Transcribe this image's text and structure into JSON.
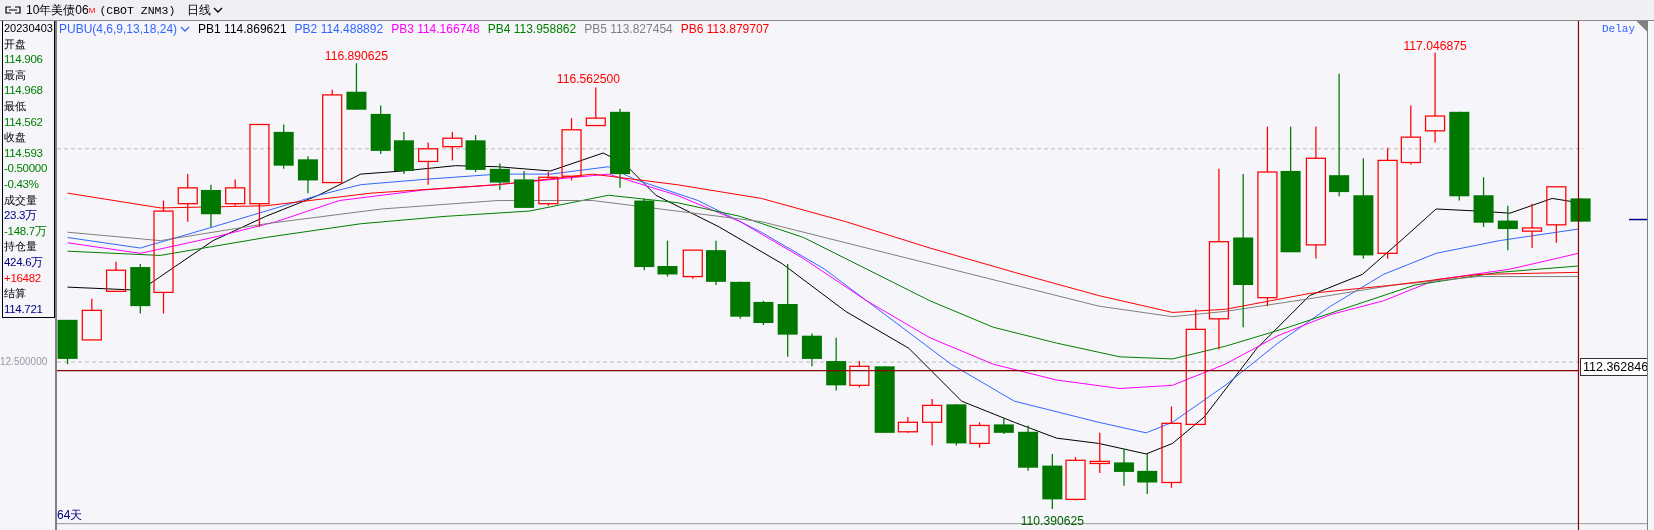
{
  "title_bar": {
    "symbol": "10年美债06",
    "symbol_mark": "M",
    "contract": "(CBOT ZNM3)",
    "period": "日线"
  },
  "info_panel": {
    "entries": [
      {
        "text": "20230403"
      },
      {
        "text": "开盘"
      },
      {
        "text": "114.906",
        "color": "#008000"
      },
      {
        "text": "最高"
      },
      {
        "text": "114.968",
        "color": "#008000"
      },
      {
        "text": "最低"
      },
      {
        "text": "114.562",
        "color": "#008000"
      },
      {
        "text": "收盘"
      },
      {
        "text": "114.593",
        "color": "#008000"
      },
      {
        "text": "-0.50000",
        "color": "#008000"
      },
      {
        "text": "-0.43%",
        "color": "#008000"
      },
      {
        "text": "成交量"
      },
      {
        "text": "23.3万",
        "color": "#000080"
      },
      {
        "text": "-148.7万",
        "color": "#008000"
      },
      {
        "text": "持仓量"
      },
      {
        "text": "424.6万",
        "color": "#000080"
      },
      {
        "text": "+16482",
        "color": "#ff0000"
      },
      {
        "text": "结算"
      },
      {
        "text": "114.721",
        "color": "#000080"
      }
    ],
    "axis_label": "12.500000"
  },
  "chart": {
    "indicator": "PUBU(4,6,9,13,18,24)",
    "legend": [
      {
        "label": "PB1",
        "value": "114.869621",
        "color": "#000000"
      },
      {
        "label": "PB2",
        "value": "114.488892",
        "color": "#3366ff"
      },
      {
        "label": "PB3",
        "value": "114.166748",
        "color": "#ff00ff"
      },
      {
        "label": "PB4",
        "value": "113.958862",
        "color": "#008000"
      },
      {
        "label": "PB5",
        "value": "113.827454",
        "color": "#808080"
      },
      {
        "label": "PB6",
        "value": "113.879707",
        "color": "#ff0000"
      }
    ],
    "extreme_labels": [
      {
        "text": "116.890625",
        "kind": "high"
      },
      {
        "text": "116.562500",
        "kind": "high"
      },
      {
        "text": "117.046875",
        "kind": "high"
      },
      {
        "text": "110.390625",
        "kind": "low"
      }
    ],
    "delay": "Delay",
    "crosshair_price": "112.362846",
    "day_count": "64天"
  }
}
